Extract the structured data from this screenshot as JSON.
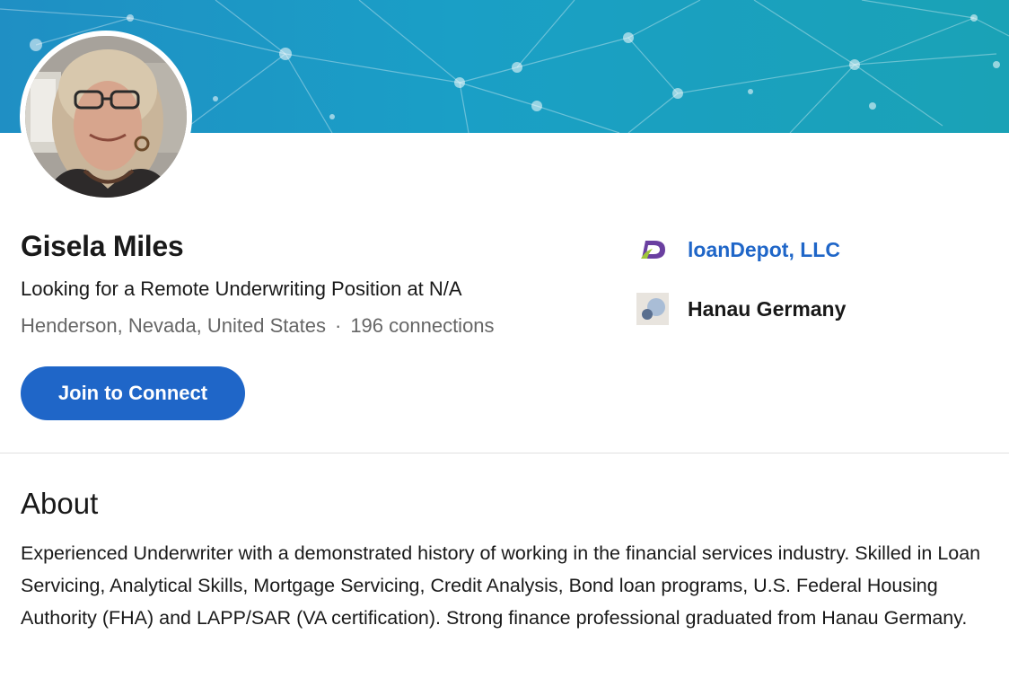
{
  "profile": {
    "name": "Gisela Miles",
    "headline": "Looking for a Remote Underwriting Position at N/A",
    "location": "Henderson, Nevada, United States",
    "separator": "·",
    "connections": "196 connections",
    "join_button_label": "Join to Connect"
  },
  "experience": {
    "company_name": "loanDepot, LLC",
    "company_logo_icon": "loandepot-logo-icon"
  },
  "education": {
    "school_name": "Hanau Germany",
    "school_logo_icon": "school-logo-icon"
  },
  "about": {
    "title": "About",
    "text": "Experienced Underwriter with a demonstrated history of working in the financial services industry. Skilled in Loan Servicing, Analytical Skills, Mortgage Servicing, Credit Analysis, Bond loan programs, U.S. Federal Housing Authority (FHA) and LAPP/SAR (VA certification). Strong finance professional graduated from Hanau Germany."
  },
  "colors": {
    "accent_blue": "#1f66c8",
    "banner_start": "#1f8fc4",
    "banner_end": "#1aa2b6",
    "secondary_text": "#666666"
  }
}
